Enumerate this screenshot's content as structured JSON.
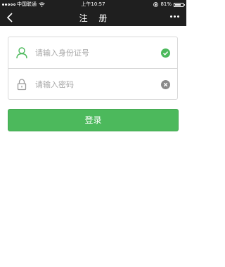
{
  "status_bar": {
    "carrier": "中国联通",
    "time": "上午10:57",
    "battery": "81%",
    "battery_level": 0.81,
    "signal_dots": 5,
    "signal_level": 2
  },
  "nav": {
    "title": "注 册",
    "back_icon": "chevron-left-icon",
    "more_icon": "more-dots-icon"
  },
  "form": {
    "id_field": {
      "placeholder": "请输入身份证号",
      "value": "",
      "icon": "user-icon",
      "status_icon": "check-circle-icon"
    },
    "password_field": {
      "placeholder": "请输入密码",
      "value": "",
      "icon": "lock-icon",
      "status_icon": "clear-circle-icon"
    }
  },
  "login_button": {
    "label": "登录"
  },
  "colors": {
    "topbar": "#1f1f1f",
    "accent": "#4cb95c",
    "clear_icon": "#8a8a8a",
    "border": "#d9d9d9",
    "placeholder": "#a6a6a6"
  }
}
